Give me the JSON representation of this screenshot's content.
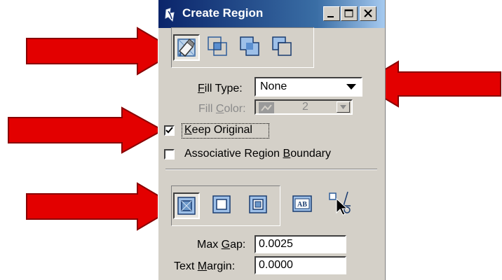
{
  "window": {
    "title": "Create Region",
    "minimize_label": "minimize",
    "maximize_label": "maximize",
    "close_label": "close"
  },
  "region_methods": [
    {
      "icon": "flood-fill-icon",
      "pressed": true
    },
    {
      "icon": "intersection-icon",
      "pressed": false
    },
    {
      "icon": "union-icon",
      "pressed": false
    },
    {
      "icon": "difference-icon",
      "pressed": false
    }
  ],
  "fill_type": {
    "label_prefix": "",
    "label_underline": "F",
    "label_rest": "ill Type:",
    "value": "None"
  },
  "fill_color": {
    "label_pre": "Fill ",
    "label_underline": "C",
    "label_rest": "olor:",
    "value": "2",
    "disabled": true
  },
  "keep_original": {
    "label_underline": "K",
    "label_rest": "eep Original",
    "checked": true
  },
  "associative_boundary": {
    "label_pre": "Associative Region ",
    "label_underline": "B",
    "label_rest": "oundary",
    "checked": false
  },
  "flood_modes": [
    {
      "icon": "flood-none-icon",
      "pressed": true
    },
    {
      "icon": "flood-holes-icon",
      "pressed": false
    },
    {
      "icon": "flood-alternating-icon",
      "pressed": false
    }
  ],
  "text_icon_label": "AB",
  "max_gap": {
    "label_pre": "Max ",
    "label_underline": "G",
    "label_rest": "ap:",
    "value": "0.0025"
  },
  "text_margin": {
    "label_pre": "Text ",
    "label_underline": "M",
    "label_rest": "argin:",
    "value": "0.0000"
  },
  "colors": {
    "arrow": "#e30000",
    "dialog_bg": "#d4d0c8",
    "titlebar_start": "#0a246a",
    "titlebar_end": "#a6caf0"
  }
}
